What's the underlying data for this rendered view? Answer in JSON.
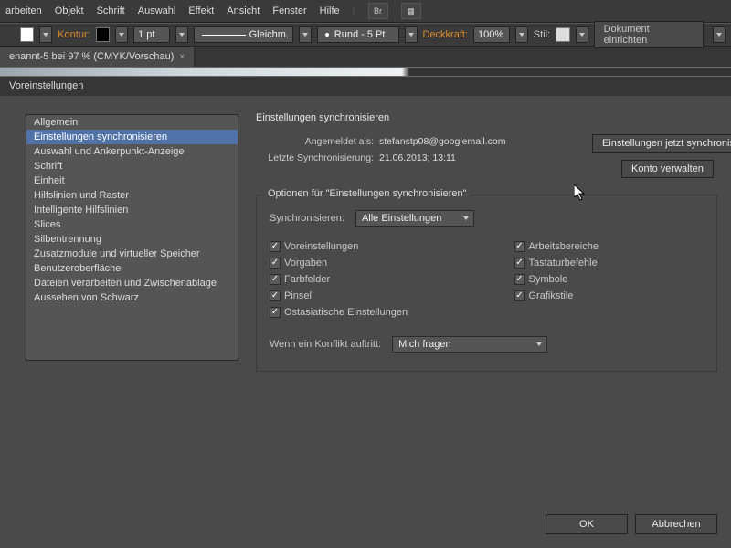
{
  "menu": {
    "items": [
      "arbeiten",
      "Objekt",
      "Schrift",
      "Auswahl",
      "Effekt",
      "Ansicht",
      "Fenster",
      "Hilfe"
    ],
    "br": "Br"
  },
  "optbar": {
    "kontur": "Kontur:",
    "pt": "1 pt",
    "gleichm": "Gleichm.",
    "rund": "Rund - 5 Pt.",
    "deckkraft": "Deckkraft:",
    "pct": "100%",
    "stil": "Stil:",
    "dokbtn": "Dokument einrichten"
  },
  "tab": {
    "title": "enannt-5 bei 97 % (CMYK/Vorschau)"
  },
  "dialog": {
    "title": "Voreinstellungen",
    "side": [
      "Allgemein",
      "Einstellungen synchronisieren",
      "Auswahl und Ankerpunkt-Anzeige",
      "Schrift",
      "Einheit",
      "Hilfslinien und Raster",
      "Intelligente Hilfslinien",
      "Slices",
      "Silbentrennung",
      "Zusatzmodule und virtueller Speicher",
      "Benutzeroberfläche",
      "Dateien verarbeiten und Zwischenablage",
      "Aussehen von Schwarz"
    ],
    "side_sel": 1,
    "panel_title": "Einstellungen synchronisieren",
    "angemeldet_k": "Angemeldet als:",
    "angemeldet_v": "stefanstp08@googlemail.com",
    "letzte_k": "Letzte Synchronisierung:",
    "letzte_v": "21.06.2013; 13:11",
    "btn_sync": "Einstellungen jetzt synchronisieren",
    "btn_konto": "Konto verwalten",
    "group_legend": "Optionen für \"Einstellungen synchronisieren\"",
    "sync_label": "Synchronisieren:",
    "sync_value": "Alle Einstellungen",
    "checks": {
      "left": [
        "Voreinstellungen",
        "Vorgaben",
        "Farbfelder",
        "Pinsel",
        "Ostasiatische Einstellungen"
      ],
      "right": [
        "Arbeitsbereiche",
        "Tastaturbefehle",
        "Symbole",
        "Grafikstile"
      ]
    },
    "conflict_label": "Wenn ein Konflikt auftritt:",
    "conflict_value": "Mich fragen",
    "ok": "OK",
    "cancel": "Abbrechen"
  }
}
